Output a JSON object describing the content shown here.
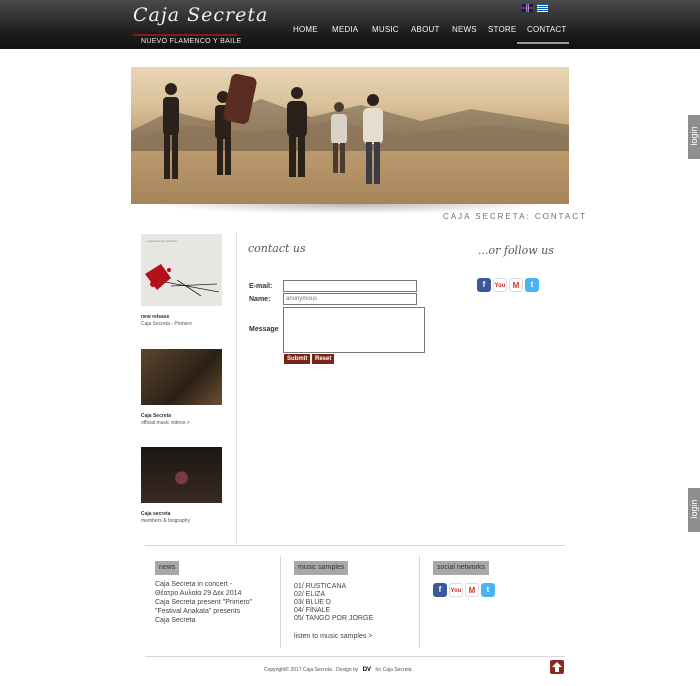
{
  "header": {
    "logo_text": "Caja Secreta",
    "logo_tagline": "NUEVO FLAMENCO Y BAILE",
    "nav": [
      "HOME",
      "MEDIA",
      "MUSIC",
      "ABOUT",
      "NEWS",
      "STORE",
      "CONTACT"
    ],
    "active_nav": "CONTACT"
  },
  "banner": {
    "caption": "CAJA SECRETA: CONTACT"
  },
  "side_tabs": [
    "login",
    "login"
  ],
  "sidebar": {
    "items": [
      {
        "title": "new release",
        "subtitle": "Caja Secreta - Primero",
        "album_text": "Caja Secreta / Primero"
      },
      {
        "title": "Caja Secreta",
        "subtitle": "official music videos >"
      },
      {
        "title": "Caja secreta",
        "subtitle": "members & biography"
      }
    ]
  },
  "contact": {
    "title": "contact us",
    "email_label": "E-mail:",
    "name_label": "Name:",
    "name_value": "anonymous",
    "message_label": "Message",
    "submit_label": "Submit",
    "reset_label": "Reset"
  },
  "follow": {
    "title": "...or follow us"
  },
  "footer": {
    "news": {
      "heading": "news",
      "lines": [
        "Caja Secreta in concert -",
        "Θέατρο Αυλαία 29 Δεκ 2014",
        "Caja Secreta present \"Primero\"",
        "\"Festival Anakata\" presents",
        "Caja Secreta"
      ]
    },
    "music": {
      "heading": "music samples",
      "tracks": [
        "01/ RUSTICANA",
        "02/ ELIZA",
        "03/ BLUE D",
        "04/ FINALE",
        "05/ TANGO POR JORGE"
      ],
      "link": "listen to music samples >"
    },
    "social": {
      "heading": "social networks"
    },
    "copyright": "Copyright© 2017 Caja Secreta . Design by",
    "designer_mark": "DV",
    "copyright_suffix": "for Caja Secreta"
  },
  "colors": {
    "accent": "#7a2418",
    "header_bg": "#1c1c1c"
  },
  "icons": [
    "facebook-icon",
    "youtube-icon",
    "gmail-icon",
    "twitter-icon",
    "arrow-up-icon"
  ]
}
